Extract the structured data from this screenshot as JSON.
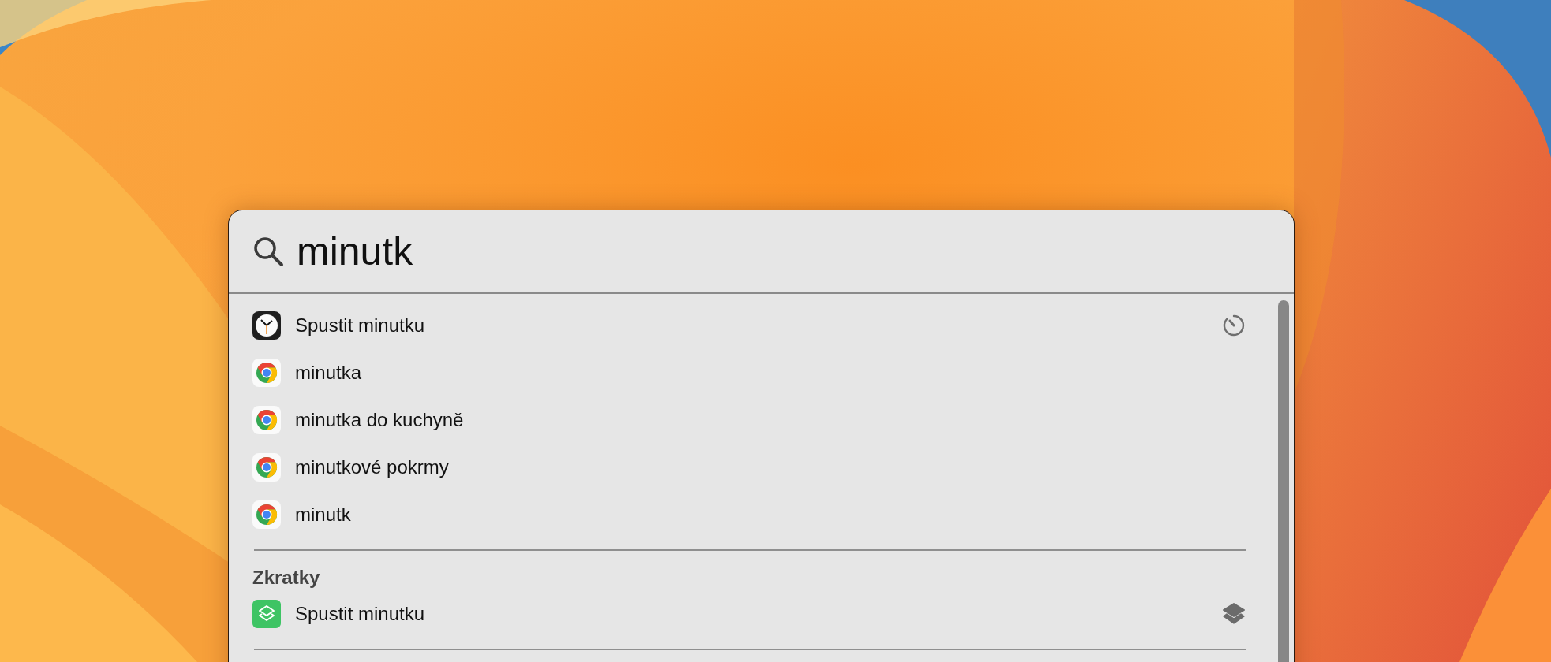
{
  "search": {
    "value": "minutk"
  },
  "sections": [
    {
      "results": [
        {
          "kind": "timer-app",
          "title": "Spustit minutku"
        },
        {
          "kind": "web",
          "title": "minutka"
        },
        {
          "kind": "web",
          "title": "minutka do kuchyně"
        },
        {
          "kind": "web",
          "title": "minutkové pokrmy"
        },
        {
          "kind": "web",
          "title": "minutk"
        }
      ]
    },
    {
      "header": "Zkratky",
      "results": [
        {
          "kind": "shortcut",
          "title": "Spustit minutku"
        }
      ]
    }
  ]
}
